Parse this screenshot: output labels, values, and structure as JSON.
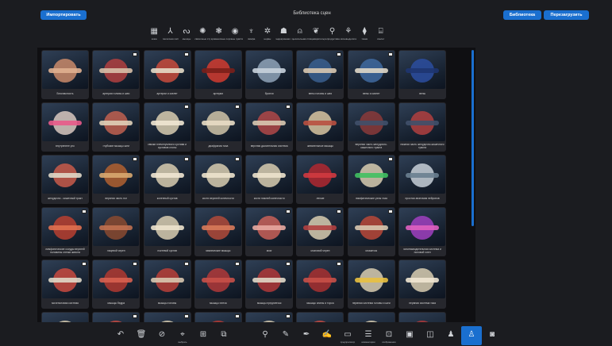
{
  "header": {
    "title": "Библиотека сцен",
    "import_label": "Импортировать",
    "library_label": "Библиотека",
    "reload_label": "Перезагрузить"
  },
  "categories": [
    {
      "label": "кожа",
      "icon": "skin-icon",
      "glyph": "▦"
    },
    {
      "label": "скелетная система",
      "icon": "skeleton-icon",
      "glyph": "⅄"
    },
    {
      "label": "мышцы",
      "icon": "muscle-icon",
      "glyph": "ᔓ"
    },
    {
      "label": "связочные структуры",
      "icon": "ligament-icon",
      "glyph": "✺"
    },
    {
      "label": "кровеносные сосуды",
      "icon": "vessels-icon",
      "glyph": "❃"
    },
    {
      "label": "органы чувств",
      "icon": "eye-icon",
      "glyph": "◉"
    },
    {
      "label": "лимфа",
      "icon": "lymph-icon",
      "glyph": "♆"
    },
    {
      "label": "нервы",
      "icon": "nerves-icon",
      "glyph": "✲"
    },
    {
      "label": "эндокринная система",
      "icon": "endocrine-icon",
      "glyph": "☗"
    },
    {
      "label": "дыхательная система",
      "icon": "lungs-icon",
      "glyph": "⍝"
    },
    {
      "label": "пищеварительная система",
      "icon": "digestive-icon",
      "glyph": "❦"
    },
    {
      "label": "репродуктивная система",
      "icon": "reproductive-icon",
      "glyph": "⚲"
    },
    {
      "label": "мочевыделительная система",
      "icon": "urinary-icon",
      "glyph": "⚘"
    },
    {
      "label": "ткани",
      "icon": "tissue-icon",
      "glyph": "⧫"
    },
    {
      "label": "скелет",
      "icon": "skeleton-full-icon",
      "glyph": "⌸"
    }
  ],
  "scenes": [
    {
      "label": "Безопасность",
      "tone": "#c98a6a",
      "tone2": "#e0b090",
      "ml": false
    },
    {
      "label": "артерии головы и шеи",
      "tone": "#b04040",
      "tone2": "#d8c0a8",
      "ml": true
    },
    {
      "label": "артерии и скелет",
      "tone": "#c84b3c",
      "tone2": "#e6dcc8",
      "ml": true
    },
    {
      "label": "артерии",
      "tone": "#d13b2f",
      "tone2": "#7a1f1a",
      "ml": false
    },
    {
      "label": "бронхи",
      "tone": "#8fa3b8",
      "tone2": "#c8d2dc",
      "ml": false
    },
    {
      "label": "вены головы и шеи",
      "tone": "#3a5f8f",
      "tone2": "#d8c8b0",
      "ml": true
    },
    {
      "label": "вены и скелет",
      "tone": "#3f6aa0",
      "tone2": "#e0d8c8",
      "ml": true
    },
    {
      "label": "вены",
      "tone": "#2b4ea0",
      "tone2": "#1e3570",
      "ml": false
    },
    {
      "label": "внутреннее ухо",
      "tone": "#d8c8c0",
      "tone2": "#e85a8a",
      "ml": false
    },
    {
      "label": "глубокие мышцы шеи",
      "tone": "#c06050",
      "tone2": "#e0d0b8",
      "ml": false
    },
    {
      "label": "связки плечелучевого сустава и суставов стопы",
      "tone": "#d8ccb0",
      "tone2": "#efe6d2",
      "ml": true
    },
    {
      "label": "диафрагма таза",
      "tone": "#d0c4a8",
      "tone2": "#e8dcc4",
      "ml": true
    },
    {
      "label": "верхняя дыхательная система",
      "tone": "#b04848",
      "tone2": "#d8c8b0",
      "ml": true
    },
    {
      "label": "жевательные мышцы",
      "tone": "#d8c4a0",
      "tone2": "#b85040",
      "ml": false
    },
    {
      "label": "верхняя часть желудочно-кишечного тракта",
      "tone": "#8a3a3a",
      "tone2": "#40506a",
      "ml": false
    },
    {
      "label": "нижняя часть желудочно-кишечного тракта",
      "tone": "#b04040",
      "tone2": "#40506a",
      "ml": false
    },
    {
      "label": "желудочно - кишечный тракт",
      "tone": "#c85a4a",
      "tone2": "#e0d8c8",
      "ml": false
    },
    {
      "label": "верхняя часть ног",
      "tone": "#b06030",
      "tone2": "#d8a870",
      "ml": true
    },
    {
      "label": "коленный сустав",
      "tone": "#d8ccb0",
      "tone2": "#efe6d2",
      "ml": true
    },
    {
      "label": "кости верхней конечности",
      "tone": "#d8ccb0",
      "tone2": "#ece2cc",
      "ml": true
    },
    {
      "label": "кости нижней конечности",
      "tone": "#d8ccb0",
      "tone2": "#ece2cc",
      "ml": false
    },
    {
      "label": "легкие",
      "tone": "#b02830",
      "tone2": "#d03a40",
      "ml": false
    },
    {
      "label": "лимфатические узлы таза",
      "tone": "#d8ccb0",
      "tone2": "#40c060",
      "ml": true
    },
    {
      "label": "простая анатомия нейронов",
      "tone": "#c8d0d8",
      "tone2": "#6a8090",
      "ml": false
    },
    {
      "label": "лимфатические сосуды верхней половины стенки живота",
      "tone": "#b84030",
      "tone2": "#e07050",
      "ml": true
    },
    {
      "label": "лицевой череп",
      "tone": "#8a4a30",
      "tone2": "#c07050",
      "ml": false
    },
    {
      "label": "локтевой сустав",
      "tone": "#d8ccb0",
      "tone2": "#ece2cc",
      "ml": false
    },
    {
      "label": "мимические мышцы",
      "tone": "#b04a3a",
      "tone2": "#d87a5a",
      "ml": false
    },
    {
      "label": "мозг",
      "tone": "#c86058",
      "tone2": "#e8a8a0",
      "ml": true
    },
    {
      "label": "мозговой череп",
      "tone": "#d8ccb0",
      "tone2": "#b04040",
      "ml": true
    },
    {
      "label": "мозжечок",
      "tone": "#b84838",
      "tone2": "#d8c8b0",
      "ml": true
    },
    {
      "label": "мочевыводительная система и половой член",
      "tone": "#a040c0",
      "tone2": "#e060c0",
      "ml": false
    },
    {
      "label": "мочеполовая система",
      "tone": "#c84a40",
      "tone2": "#e0d8c8",
      "ml": true
    },
    {
      "label": "мышцы бедра",
      "tone": "#b03830",
      "tone2": "#d86050",
      "ml": true
    },
    {
      "label": "мышцы головы",
      "tone": "#b84038",
      "tone2": "#d8c8b0",
      "ml": true
    },
    {
      "label": "мышцы плеча",
      "tone": "#b03838",
      "tone2": "#c85048",
      "ml": true
    },
    {
      "label": "мышцы предплечья",
      "tone": "#b03838",
      "tone2": "#e0d8c8",
      "ml": true
    },
    {
      "label": "мышцы спины и торса",
      "tone": "#a83030",
      "tone2": "#c85048",
      "ml": true
    },
    {
      "label": "нервная система головы и шеи",
      "tone": "#d8ccb0",
      "tone2": "#e8c040",
      "ml": false
    },
    {
      "label": "нервная система таза",
      "tone": "#d8ccb0",
      "tone2": "#efe6d2",
      "ml": false
    },
    {
      "label": "",
      "tone": "#d8ccb0",
      "tone2": "#ece2cc",
      "ml": false
    },
    {
      "label": "",
      "tone": "#c84a40",
      "tone2": "#e0d8c8",
      "ml": true
    },
    {
      "label": "",
      "tone": "#d8ccb0",
      "tone2": "#ece2cc",
      "ml": true
    },
    {
      "label": "",
      "tone": "#b83a30",
      "tone2": "#d8c8b0",
      "ml": true
    },
    {
      "label": "",
      "tone": "#d8ccb0",
      "tone2": "#ece2cc",
      "ml": true
    },
    {
      "label": "",
      "tone": "#c84a40",
      "tone2": "#e0d8c8",
      "ml": false
    },
    {
      "label": "",
      "tone": "#d8ccb0",
      "tone2": "#ece2cc",
      "ml": false
    },
    {
      "label": "",
      "tone": "#b03838",
      "tone2": "#d8c8b0",
      "ml": false
    }
  ],
  "tools": [
    {
      "label": "",
      "icon": "undo-icon",
      "glyph": "↶",
      "active": false
    },
    {
      "label": "",
      "icon": "trash-icon",
      "glyph": "🗑",
      "active": false
    },
    {
      "label": "",
      "icon": "hide-icon",
      "glyph": "⊘",
      "active": false
    },
    {
      "label": "выбрать",
      "icon": "select-icon",
      "glyph": "⌖",
      "active": false
    },
    {
      "label": "",
      "icon": "hierarchy-icon",
      "glyph": "⊞",
      "active": false
    },
    {
      "label": "",
      "icon": "explode-icon",
      "glyph": "⧉",
      "active": false
    },
    {
      "label": "",
      "icon": "spacer",
      "glyph": "",
      "active": false
    },
    {
      "label": "",
      "icon": "pin-icon",
      "glyph": "⚲",
      "active": false
    },
    {
      "label": "",
      "icon": "pencil-icon",
      "glyph": "✎",
      "active": false
    },
    {
      "label": "",
      "icon": "pen-icon",
      "glyph": "✒",
      "active": false
    },
    {
      "label": "",
      "icon": "notes-icon",
      "glyph": "✍",
      "active": false
    },
    {
      "label": "предпросмотр",
      "icon": "preview-icon",
      "glyph": "▭",
      "active": false
    },
    {
      "label": "комментарии",
      "icon": "comment-icon",
      "glyph": "☰",
      "active": false
    },
    {
      "label": "изображения",
      "icon": "image-icon",
      "glyph": "⊡",
      "active": false
    },
    {
      "label": "",
      "icon": "gallery-icon",
      "glyph": "▣",
      "active": false
    },
    {
      "label": "",
      "icon": "vr-icon",
      "glyph": "◫",
      "active": false
    },
    {
      "label": "",
      "icon": "person-icon",
      "glyph": "♟",
      "active": false
    },
    {
      "label": "",
      "icon": "anatomy-icon",
      "glyph": "♙",
      "active": true
    },
    {
      "label": "",
      "icon": "camera-icon",
      "glyph": "◙",
      "active": false
    }
  ]
}
